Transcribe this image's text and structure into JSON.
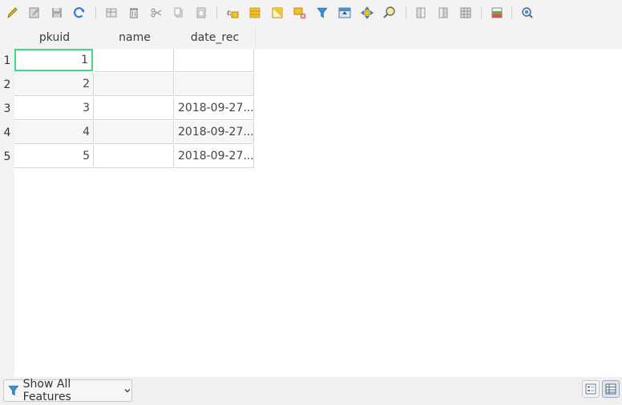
{
  "toolbar": {
    "tools": [
      {
        "name": "toggle-editing-icon",
        "color": "#e0b020"
      },
      {
        "name": "multi-edit-icon",
        "color": "#9a9a9a"
      },
      {
        "name": "save-edits-icon",
        "color": "#9a9a9a"
      },
      {
        "name": "reload-icon",
        "color": "#2f7fd0"
      },
      {
        "name": "add-feature-icon",
        "color": "#9a9a9a"
      },
      {
        "name": "delete-feature-icon",
        "color": "#9a9a9a"
      },
      {
        "name": "cut-icon",
        "color": "#9a9a9a"
      },
      {
        "name": "copy-icon",
        "color": "#9a9a9a"
      },
      {
        "name": "paste-icon",
        "color": "#9a9a9a"
      },
      {
        "name": "select-by-expression-icon",
        "color": "#e6b800"
      },
      {
        "name": "select-all-icon",
        "color": "#e6b800"
      },
      {
        "name": "invert-selection-icon",
        "color": "#e6b800"
      },
      {
        "name": "deselect-all-icon",
        "color": "#e6b800"
      },
      {
        "name": "filter-select-icon",
        "color": "#3a8fd0"
      },
      {
        "name": "move-selection-to-top-icon",
        "color": "#3a8fd0"
      },
      {
        "name": "pan-to-selected-icon",
        "color": "#e6b800"
      },
      {
        "name": "zoom-to-selected-icon",
        "color": "#e6b800"
      },
      {
        "name": "new-field-icon",
        "color": "#9a9a9a"
      },
      {
        "name": "delete-field-icon",
        "color": "#9a9a9a"
      },
      {
        "name": "field-calculator-icon",
        "color": "#9a9a9a"
      },
      {
        "name": "conditional-formatting-icon",
        "color": "#6aa84f"
      },
      {
        "name": "dock-actions-icon",
        "color": "#3a8fd0"
      }
    ]
  },
  "table": {
    "columns": [
      "pkuid",
      "name",
      "date_rec"
    ],
    "rows": [
      {
        "num": "1",
        "pkuid": "1",
        "name": "",
        "date_rec": ""
      },
      {
        "num": "2",
        "pkuid": "2",
        "name": "",
        "date_rec": ""
      },
      {
        "num": "3",
        "pkuid": "3",
        "name": "",
        "date_rec": "2018-09-27..."
      },
      {
        "num": "4",
        "pkuid": "4",
        "name": "",
        "date_rec": "2018-09-27..."
      },
      {
        "num": "5",
        "pkuid": "5",
        "name": "",
        "date_rec": "2018-09-27..."
      }
    ]
  },
  "bottom": {
    "filter_label": "Show All Features",
    "filter_icon": "filter-icon",
    "form_view_icon": "form-view-icon",
    "table_view_icon": "table-view-icon"
  }
}
